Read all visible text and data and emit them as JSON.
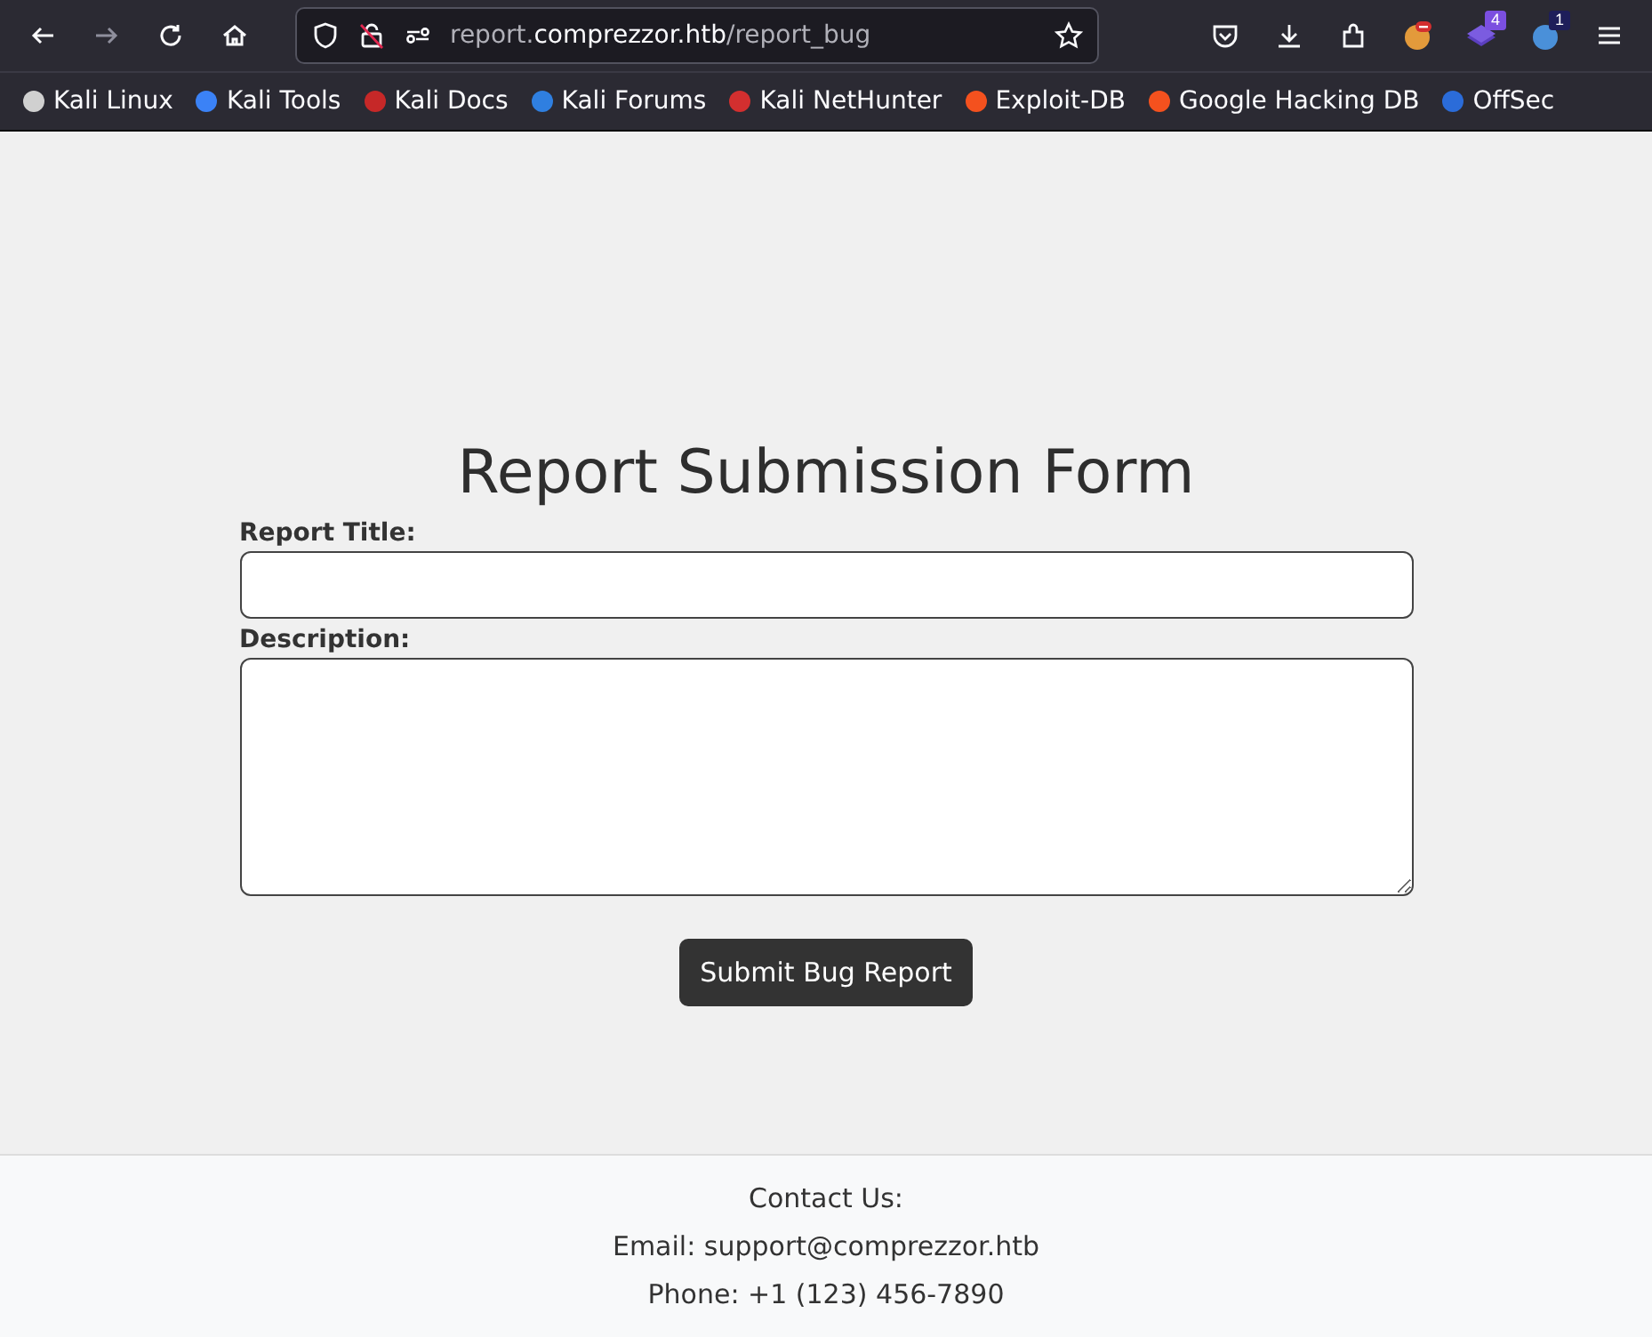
{
  "browser": {
    "nav_buttons": [
      {
        "kind": "back",
        "disabled": false
      },
      {
        "kind": "forward",
        "disabled": true
      },
      {
        "kind": "reload",
        "disabled": false
      },
      {
        "kind": "home",
        "disabled": false
      }
    ],
    "url": {
      "prefix": "report.",
      "domain": "comprezzor.htb",
      "path": "/report_bug"
    },
    "toolbar_icons": [
      {
        "kind": "pocket"
      },
      {
        "kind": "download"
      },
      {
        "kind": "extensions"
      },
      {
        "kind": "ext-orange"
      },
      {
        "kind": "ext-purple",
        "badge": "4"
      },
      {
        "kind": "ext-blue",
        "badge": "1"
      },
      {
        "kind": "menu"
      }
    ],
    "bookmarks": [
      {
        "label": "Kali Linux",
        "color": "#d0d0d0"
      },
      {
        "label": "Kali Tools",
        "color": "#3b82f6"
      },
      {
        "label": "Kali Docs",
        "color": "#c62828"
      },
      {
        "label": "Kali Forums",
        "color": "#2f7fe0"
      },
      {
        "label": "Kali NetHunter",
        "color": "#d32f2f"
      },
      {
        "label": "Exploit-DB",
        "color": "#f4511e"
      },
      {
        "label": "Google Hacking DB",
        "color": "#f4511e"
      },
      {
        "label": "OffSec",
        "color": "#2b6cd9"
      }
    ]
  },
  "form": {
    "heading": "Report Submission Form",
    "fields": [
      {
        "label": "Report Title:",
        "kind": "input"
      },
      {
        "label": "Description:",
        "kind": "textarea"
      }
    ],
    "submit": "Submit Bug Report"
  },
  "footer": {
    "lines": [
      "Contact Us:",
      "Email: support@comprezzor.htb",
      "Phone: +1 (123) 456-7890"
    ]
  }
}
